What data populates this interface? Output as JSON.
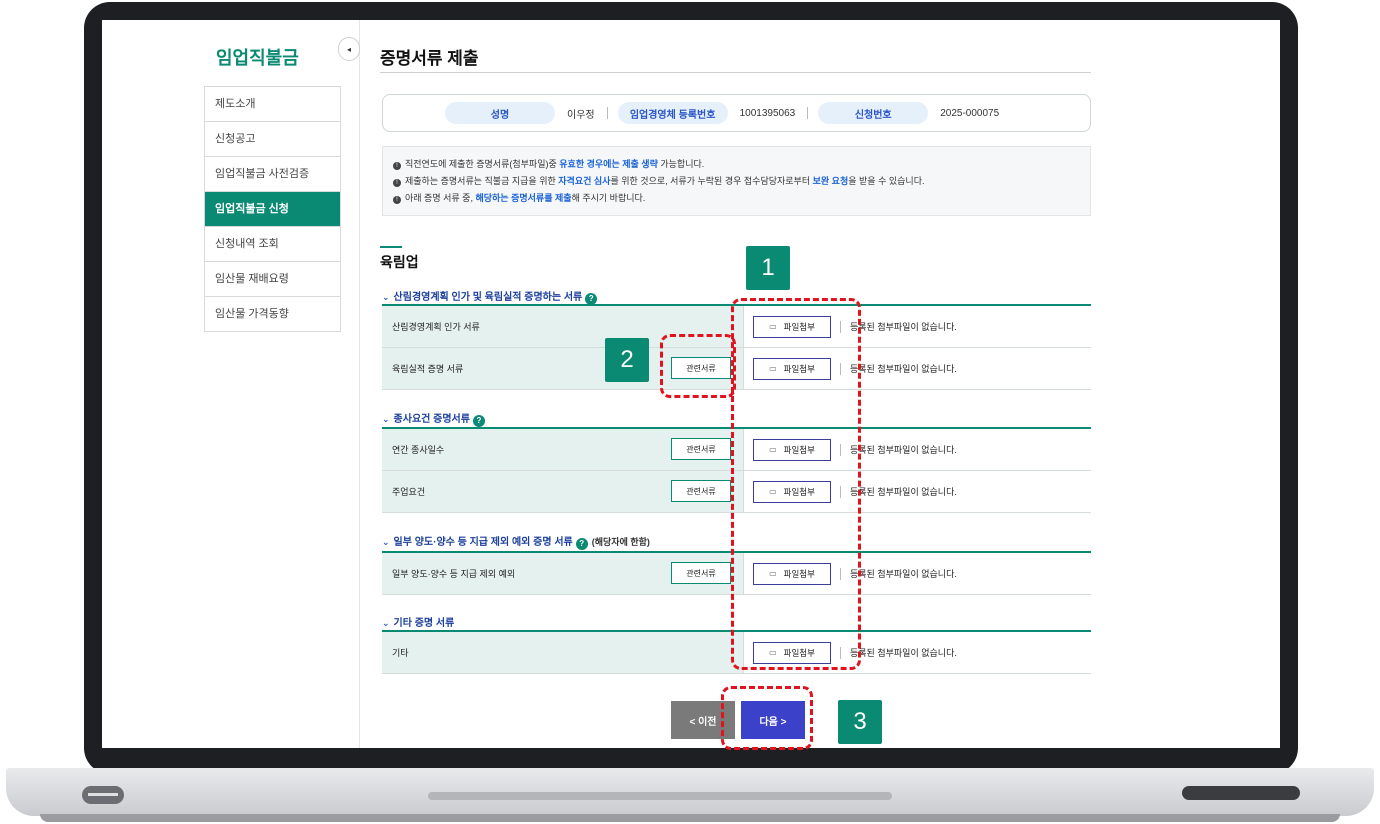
{
  "sidebar": {
    "title": "임업직불금",
    "toggle": "◂",
    "items": [
      {
        "label": "제도소개"
      },
      {
        "label": "신청공고"
      },
      {
        "label": "임업직불금 사전검증"
      },
      {
        "label": "임업직불금 신청"
      },
      {
        "label": "신청내역 조회"
      },
      {
        "label": "임산물 재배요령"
      },
      {
        "label": "임산물 가격동향"
      }
    ]
  },
  "page": {
    "title": "증명서류 제출",
    "info": {
      "name_label": "성명",
      "name_value": "이우정",
      "reg_label": "임업경영체 등록번호",
      "reg_value": "1001395063",
      "app_label": "신청번호",
      "app_value": "2025-000075"
    },
    "notice": [
      {
        "pre": "직전연도에 제출한 증명서류(첨부파일)중 ",
        "em": "유효한 경우에는 제출 생략",
        "post": " 가능합니다."
      },
      {
        "pre": "제출하는 증명서류는 직불금 지급을 위한 ",
        "em": "자격요건 심사",
        "post": "를 위한 것으로, 서류가 누락된 경우 접수담당자로부터 ",
        "em2": "보완 요청",
        "post2": "을 받을 수 있습니다."
      },
      {
        "pre": "아래 증명 서류 중, ",
        "em": "해당하는 증명서류를 제출",
        "post": "해 주시기 바랍니다."
      }
    ],
    "section": "육림업",
    "groups": [
      {
        "title": "산림경영계획 인가 및 육림실적 증명하는 서류",
        "sub": "",
        "rows": [
          {
            "label": "산림경영계획 인가 서류",
            "related": ""
          },
          {
            "label": "육림실적 증명 서류",
            "related": "관련서류"
          }
        ]
      },
      {
        "title": "종사요건 증명서류",
        "sub": "",
        "rows": [
          {
            "label": "연간 종사일수",
            "related": "관련서류"
          },
          {
            "label": "주업요건",
            "related": "관련서류"
          }
        ]
      },
      {
        "title": "일부 양도·양수 등 지급 제외 예외 증명 서류",
        "sub": "(해당자에 한함)",
        "rows": [
          {
            "label": "일부 양도·양수 등 지급 제외 예외",
            "related": "관련서류"
          }
        ]
      },
      {
        "title": "기타 증명 서류",
        "sub": "",
        "rows": [
          {
            "label": "기타",
            "related": ""
          }
        ]
      }
    ],
    "attach_label": "파일첨부",
    "file_status": "등록된 첨부파일이 없습니다.",
    "prev_label": "< 이전",
    "next_label": "다음 >"
  },
  "annotations": [
    "1",
    "2",
    "3"
  ],
  "colors": {
    "brand": "#0a8a73",
    "next": "#3b41c8",
    "annotation": "#e0141e"
  }
}
